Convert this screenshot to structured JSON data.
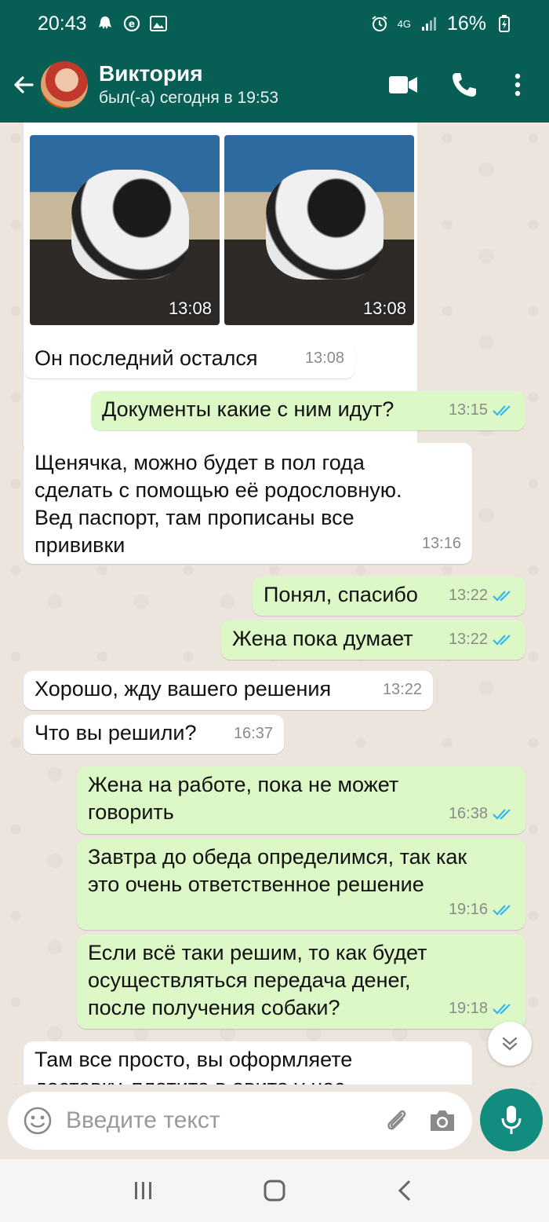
{
  "status_bar": {
    "time": "20:43",
    "network": "4G",
    "battery": "16%"
  },
  "header": {
    "name": "Виктория",
    "status": "был(-а) сегодня в 19:53"
  },
  "album": {
    "photo_times": [
      "13:08",
      "13:08"
    ]
  },
  "messages": [
    {
      "dir": "in",
      "text": "Он последний остался",
      "time": "13:08"
    },
    {
      "dir": "out",
      "text": "Документы какие с ним идут?",
      "time": "13:15",
      "read": true
    },
    {
      "dir": "in",
      "text": "Щенячка, можно будет в пол года\nсделать с помощью её родословную.\nВед паспорт, там прописаны все\nпрививки",
      "time": "13:16"
    },
    {
      "dir": "out",
      "text": "Понял, спасибо",
      "time": "13:22",
      "read": true
    },
    {
      "dir": "out",
      "text": "Жена пока думает",
      "time": "13:22",
      "read": true
    },
    {
      "dir": "in",
      "text": "Хорошо, жду вашего решения",
      "time": "13:22"
    },
    {
      "dir": "in",
      "text": "Что вы решили?",
      "time": "16:37"
    },
    {
      "dir": "out",
      "text": "Жена на работе, пока не может\nговорить",
      "time": "16:38",
      "read": true
    },
    {
      "dir": "out",
      "text": "Завтра до обеда определимся, так как\nэто очень ответственное решение",
      "time": "19:16",
      "read": true
    },
    {
      "dir": "out",
      "text": "Если всё таки решим, то как будет\nосуществляться передача денег,\nпосле получения собаки?",
      "time": "19:18",
      "read": true
    },
    {
      "dir": "in",
      "text": "Там все просто, вы оформляете\nдоставку, платите в авито у нас",
      "time": ""
    }
  ],
  "input": {
    "placeholder": "Введите текст"
  },
  "colors": {
    "header": "#075e54",
    "outgoing": "#dcf8c6",
    "incoming": "#ffffff",
    "tick_read": "#34b7f1",
    "accent": "#128c7e"
  }
}
